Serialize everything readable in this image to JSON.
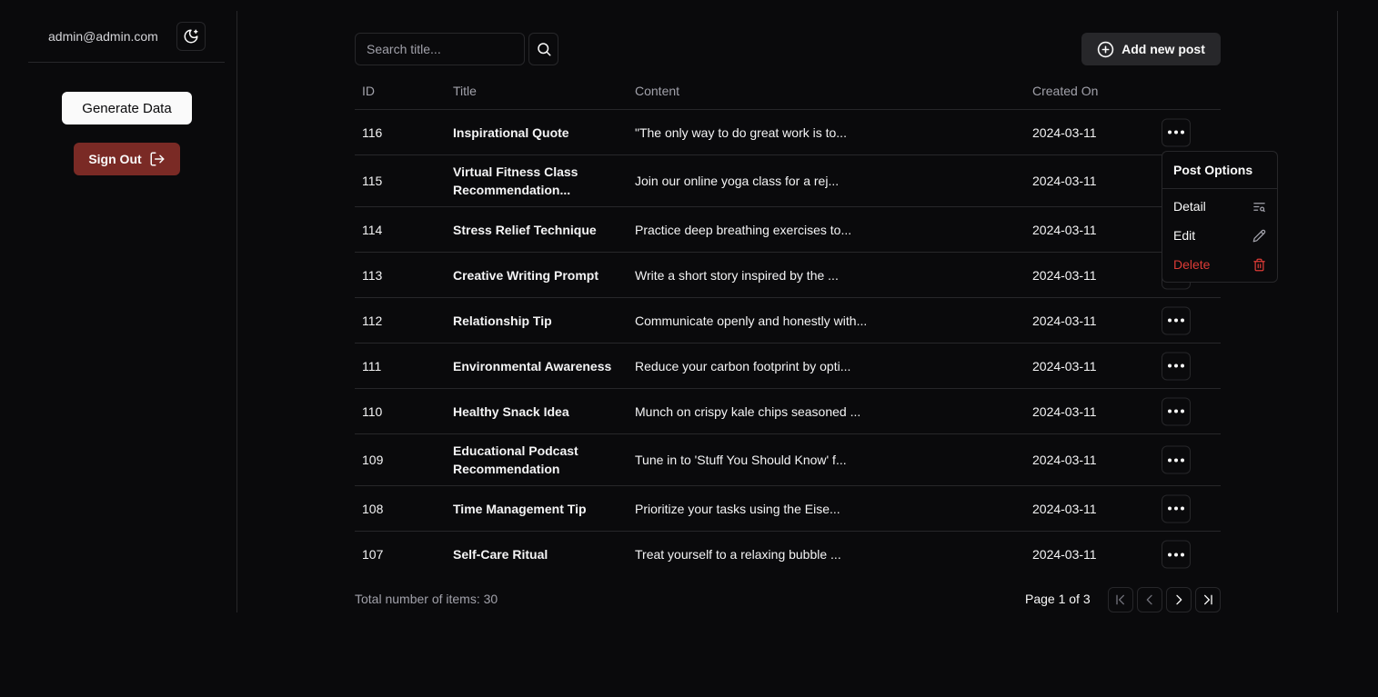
{
  "sidebar": {
    "email": "admin@admin.com",
    "generate_label": "Generate Data",
    "signout_label": "Sign Out"
  },
  "search": {
    "placeholder": "Search title..."
  },
  "add_post_label": "Add new post",
  "table": {
    "headers": [
      "ID",
      "Title",
      "Content",
      "Created On"
    ],
    "rows": [
      {
        "id": "116",
        "title": "Inspirational Quote",
        "content": "\"The only way to do great work is to...",
        "date": "2024-03-11"
      },
      {
        "id": "115",
        "title": "Virtual Fitness Class Recommendation...",
        "content": "Join our online yoga class for a rej...",
        "date": "2024-03-11"
      },
      {
        "id": "114",
        "title": "Stress Relief Technique",
        "content": "Practice deep breathing exercises to...",
        "date": "2024-03-11"
      },
      {
        "id": "113",
        "title": "Creative Writing Prompt",
        "content": "Write a short story inspired by the ...",
        "date": "2024-03-11"
      },
      {
        "id": "112",
        "title": "Relationship Tip",
        "content": "Communicate openly and honestly with...",
        "date": "2024-03-11"
      },
      {
        "id": "111",
        "title": "Environmental Awareness",
        "content": "Reduce your carbon footprint by opti...",
        "date": "2024-03-11"
      },
      {
        "id": "110",
        "title": "Healthy Snack Idea",
        "content": "Munch on crispy kale chips seasoned ...",
        "date": "2024-03-11"
      },
      {
        "id": "109",
        "title": "Educational Podcast Recommendation",
        "content": "Tune in to 'Stuff You Should Know' f...",
        "date": "2024-03-11"
      },
      {
        "id": "108",
        "title": "Time Management Tip",
        "content": "Prioritize your tasks using the Eise...",
        "date": "2024-03-11"
      },
      {
        "id": "107",
        "title": "Self-Care Ritual",
        "content": "Treat yourself to a relaxing bubble ...",
        "date": "2024-03-11"
      }
    ]
  },
  "menu": {
    "title": "Post Options",
    "detail": "Detail",
    "edit": "Edit",
    "delete": "Delete"
  },
  "footer": {
    "total": "Total number of items: 30",
    "page": "Page 1 of 3"
  },
  "colors": {
    "background": "#0a0a0c",
    "border": "#27272a",
    "signout": "#7a2a25",
    "delete": "#dc3b36"
  }
}
